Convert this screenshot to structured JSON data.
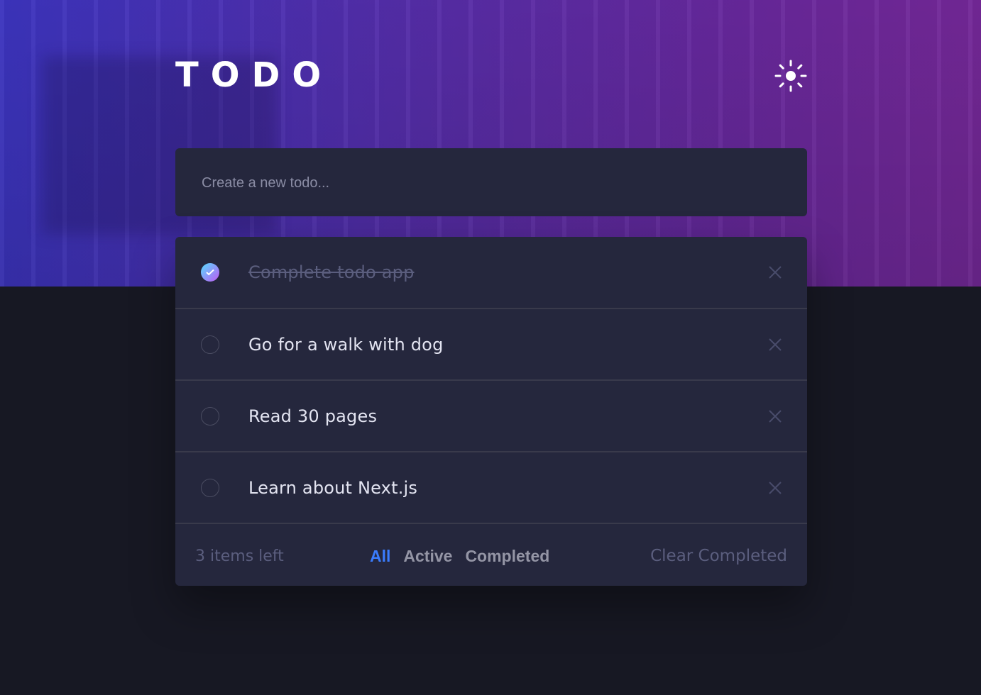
{
  "app": {
    "title": "TODO",
    "theme_icon": "sun-icon"
  },
  "new_todo": {
    "placeholder": "Create a new todo..."
  },
  "todos": [
    {
      "text": "Complete todo app",
      "completed": true
    },
    {
      "text": "Go for a walk with dog",
      "completed": false
    },
    {
      "text": "Read 30 pages",
      "completed": false
    },
    {
      "text": "Learn about Next.js",
      "completed": false
    }
  ],
  "footer": {
    "items_left": "3 items left",
    "filters": [
      "All",
      "Active",
      "Completed"
    ],
    "active_filter": "All",
    "clear_label": "Clear Completed"
  },
  "colors": {
    "background": "#171823",
    "card": "#25273d",
    "accent": "#3a7cfd",
    "check_gradient_start": "#55ddff",
    "check_gradient_end": "#c058f3"
  }
}
